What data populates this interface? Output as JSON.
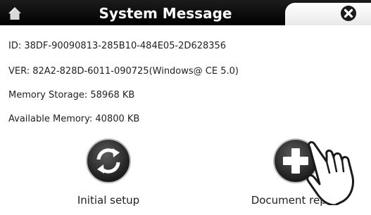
{
  "window": {
    "title": "System Message",
    "home_icon": "home-icon",
    "close_icon": "close-icon"
  },
  "info": {
    "id_line": "ID: 38DF-90090813-285B10-484E05-2D628356",
    "ver_line": "VER: 82A2-828D-6011-090725(Windows@ CE 5.0)",
    "memory_storage_line": "Memory Storage: 58968 KB",
    "available_memory_line": "Available Memory: 40800 KB"
  },
  "actions": {
    "initial_setup": {
      "label": "Initial setup",
      "icon": "refresh-icon"
    },
    "document_repair": {
      "label": "Document repair",
      "icon": "plus-icon"
    }
  },
  "colors": {
    "titlebar": "#000000",
    "title_text": "#ffffff",
    "button_dark": "#2a2a2a",
    "background": "#ffffff"
  }
}
